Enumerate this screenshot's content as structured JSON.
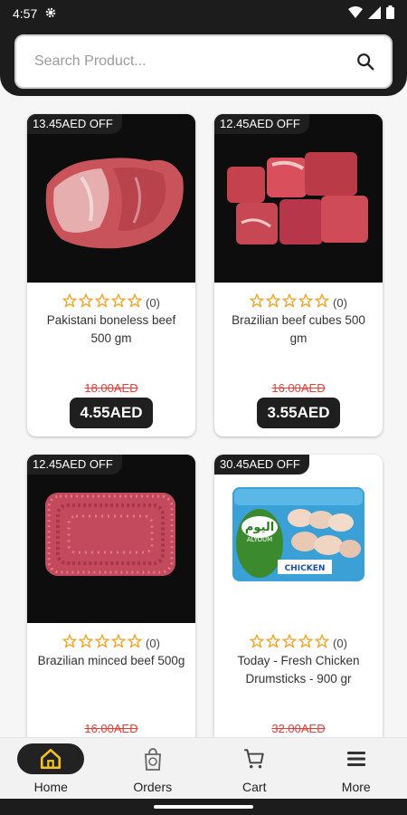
{
  "status_bar": {
    "time": "4:57",
    "icons": [
      "gear-icon",
      "wifi-icon",
      "signal-icon",
      "battery-icon"
    ]
  },
  "search": {
    "placeholder": "Search Product..."
  },
  "colors": {
    "accent": "#f4c21b",
    "dark": "#1c1c1c",
    "strike_price": "#e0403a",
    "star": "#f0a020"
  },
  "products": [
    {
      "badge": "13.45AED OFF",
      "rating_count": "(0)",
      "name": "Pakistani boneless beef 500 gm",
      "old_price": "18.00AED",
      "price": "4.55AED",
      "image": "boneless-beef-image"
    },
    {
      "badge": "12.45AED OFF",
      "rating_count": "(0)",
      "name": "Brazilian beef cubes 500 gm",
      "old_price": "16.00AED",
      "price": "3.55AED",
      "image": "beef-cubes-image"
    },
    {
      "badge": "12.45AED OFF",
      "rating_count": "(0)",
      "name": "Brazilian minced beef 500g",
      "old_price": "16.00AED",
      "price": "",
      "image": "minced-beef-image"
    },
    {
      "badge": "30.45AED OFF",
      "rating_count": "(0)",
      "name": "Today - Fresh Chicken Drumsticks - 900 gr",
      "old_price": "32.00AED",
      "price": "",
      "image": "chicken-drumsticks-image",
      "package_text": {
        "brand_arabic": "اليوم",
        "brand": "ALYOUM",
        "product": "CHICKEN"
      }
    }
  ],
  "nav": [
    {
      "label": "Home",
      "icon": "home-icon",
      "active": true
    },
    {
      "label": "Orders",
      "icon": "orders-icon",
      "active": false
    },
    {
      "label": "Cart",
      "icon": "cart-icon",
      "active": false
    },
    {
      "label": "More",
      "icon": "menu-icon",
      "active": false
    }
  ]
}
